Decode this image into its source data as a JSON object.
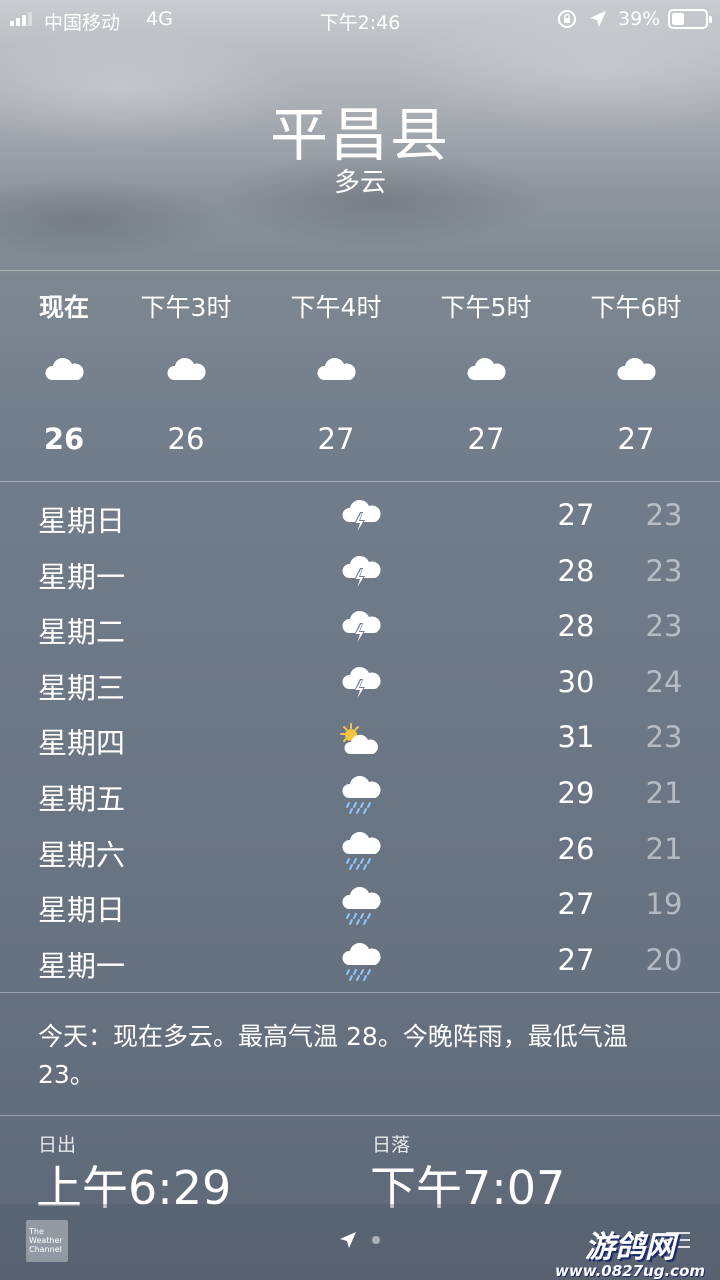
{
  "status_bar": {
    "carrier": "中国移动",
    "network": "4G",
    "time": "下午2:46",
    "battery_percent": "39%",
    "battery_level": 0.39
  },
  "location": {
    "city": "平昌县",
    "condition": "多云"
  },
  "hourly": [
    {
      "label": "现在",
      "icon": "cloud-icon",
      "temp": "26"
    },
    {
      "label": "下午3时",
      "icon": "cloud-icon",
      "temp": "26"
    },
    {
      "label": "下午4时",
      "icon": "cloud-icon",
      "temp": "27"
    },
    {
      "label": "下午5时",
      "icon": "cloud-icon",
      "temp": "27"
    },
    {
      "label": "下午6时",
      "icon": "cloud-icon",
      "temp": "27"
    }
  ],
  "daily": [
    {
      "day": "星期日",
      "icon": "thunderstorm-icon",
      "high": "27",
      "low": "23"
    },
    {
      "day": "星期一",
      "icon": "thunderstorm-icon",
      "high": "28",
      "low": "23"
    },
    {
      "day": "星期二",
      "icon": "thunderstorm-icon",
      "high": "28",
      "low": "23"
    },
    {
      "day": "星期三",
      "icon": "thunderstorm-icon",
      "high": "30",
      "low": "24"
    },
    {
      "day": "星期四",
      "icon": "partly-sunny-icon",
      "high": "31",
      "low": "23"
    },
    {
      "day": "星期五",
      "icon": "rain-icon",
      "high": "29",
      "low": "21"
    },
    {
      "day": "星期六",
      "icon": "rain-icon",
      "high": "26",
      "low": "21"
    },
    {
      "day": "星期日",
      "icon": "rain-icon",
      "high": "27",
      "low": "19"
    },
    {
      "day": "星期一",
      "icon": "rain-icon",
      "high": "27",
      "low": "20"
    }
  ],
  "summary": "今天：现在多云。最高气温 28。今晚阵雨，最低气温 23。",
  "sun": {
    "sunrise_label": "日出",
    "sunrise_time": "上午6:29",
    "sunset_label": "日落",
    "sunset_time": "下午7:07"
  },
  "footer": {
    "provider_logo_text": "The Weather Channel",
    "watermark_title": "游鸽网",
    "watermark_url": "www.0827ug.com"
  },
  "colors": {
    "text": "#ffffff",
    "low_temp": "rgba(255,255,255,0.5)",
    "sun_yellow": "#f5c542",
    "rain_blue": "#8ec5ff"
  }
}
